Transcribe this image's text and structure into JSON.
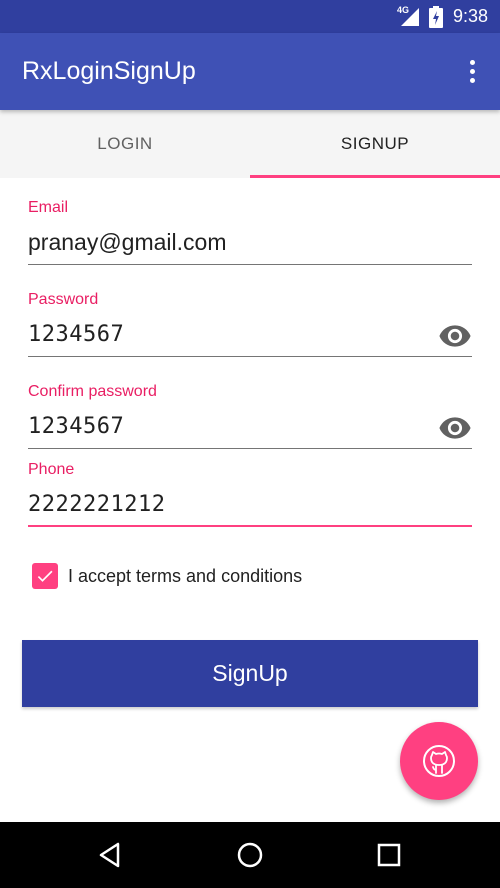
{
  "status_bar": {
    "network": "4G",
    "time": "9:38"
  },
  "app_bar": {
    "title": "RxLoginSignUp",
    "menu_icon": "more-vert-icon"
  },
  "tabs": [
    {
      "label": "LOGIN",
      "active": false
    },
    {
      "label": "SIGNUP",
      "active": true
    }
  ],
  "form": {
    "email": {
      "label": "Email",
      "value": "pranay@gmail.com"
    },
    "password": {
      "label": "Password",
      "value": "1234567",
      "icon": "eye-icon"
    },
    "confirm_password": {
      "label": "Confirm password",
      "value": "1234567",
      "icon": "eye-icon"
    },
    "phone": {
      "label": "Phone",
      "value": "2222221212",
      "focused": true
    },
    "terms": {
      "label": "I accept terms and conditions",
      "checked": true
    }
  },
  "signup_button": {
    "label": "SignUp"
  },
  "fab": {
    "icon": "github-icon"
  },
  "nav_bar": {
    "icons": [
      "back-icon",
      "home-icon",
      "recents-icon"
    ]
  },
  "colors": {
    "primary": "#3f51b5",
    "primary_dark": "#303f9f",
    "accent": "#ff4081",
    "label": "#e91e63"
  }
}
